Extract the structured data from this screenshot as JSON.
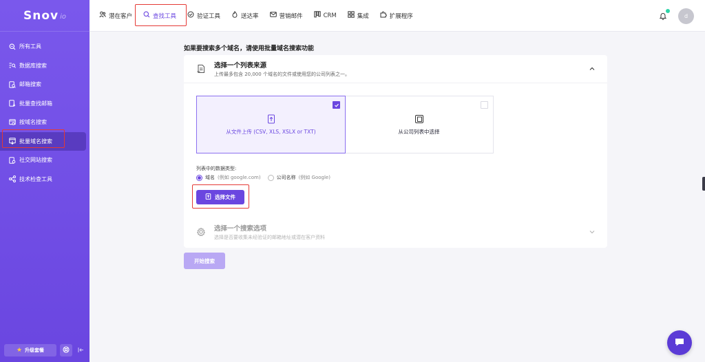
{
  "brand": {
    "name": "Snov",
    "suffix": "io"
  },
  "sidebar": {
    "items": [
      {
        "label": "所有工具",
        "icon": "zoom-icon"
      },
      {
        "label": "数据库搜索",
        "icon": "list-search-icon"
      },
      {
        "label": "邮箱搜索",
        "icon": "doc-search-icon"
      },
      {
        "label": "批量查找邮箱",
        "icon": "doc-download-icon"
      },
      {
        "label": "按域名搜索",
        "icon": "window-search-icon"
      },
      {
        "label": "批量域名搜索",
        "icon": "window-list-icon"
      },
      {
        "label": "社交网站搜索",
        "icon": "doc-link-icon"
      },
      {
        "label": "技术检查工具",
        "icon": "share-nodes-icon"
      }
    ],
    "upgrade_label": "升级套餐"
  },
  "topbar": {
    "tabs": [
      {
        "label": "潜在客户",
        "icon": "users-icon"
      },
      {
        "label": "查找工具",
        "icon": "search-icon"
      },
      {
        "label": "验证工具",
        "icon": "check-circle-icon"
      },
      {
        "label": "送达率",
        "icon": "flame-icon"
      },
      {
        "label": "营销邮件",
        "icon": "mail-icon"
      },
      {
        "label": "CRM",
        "icon": "kanban-icon"
      },
      {
        "label": "集成",
        "icon": "grid-icon"
      },
      {
        "label": "扩展程序",
        "icon": "puzzle-icon"
      }
    ],
    "avatar_letter": "d"
  },
  "main": {
    "heading": "如果要搜索多个域名，请使用批量域名搜索功能",
    "step1": {
      "title": "选择一个列表来源",
      "subtitle": "上传最多包含 20,000 个域名的文件或使用您的公司列表之一。",
      "option_upload": "从文件上传 (CSV, XLS, XSLX or TXT)",
      "option_company": "从公司列表中选择",
      "type_label": "列表中的数据类型:",
      "radio_domain": "域名",
      "radio_domain_hint": "(例如 google.com)",
      "radio_company": "公司名称",
      "radio_company_hint": "(例如 Google)",
      "choose_file": "选择文件"
    },
    "step2": {
      "title": "选择一个搜索选项",
      "subtitle": "选择是否要收集未经验证的邮箱地址或潜在客户资料"
    },
    "start_button": "开始搜索"
  },
  "colors": {
    "accent": "#6a46e0",
    "sidebar": "#7a58ec",
    "highlight": "#e53935",
    "notify": "#2dd4a8"
  }
}
